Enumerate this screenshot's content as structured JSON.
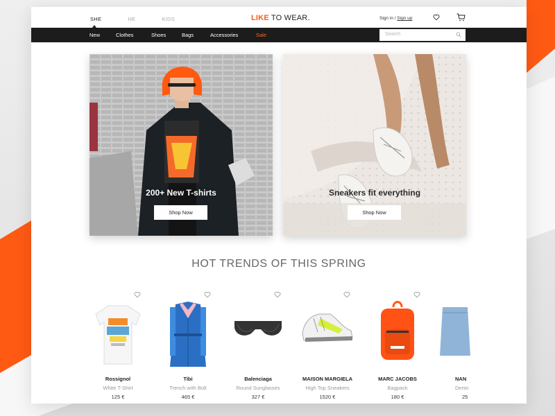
{
  "header": {
    "gender_tabs": [
      {
        "label": "SHE",
        "active": true
      },
      {
        "label": "HE",
        "active": false
      },
      {
        "label": "KIDS",
        "active": false
      }
    ],
    "logo_brand": "LIKE",
    "logo_rest": " TO WEAR.",
    "sign_in": "Sign in",
    "separator": " / ",
    "sign_up": "Sign up"
  },
  "nav": {
    "items": [
      "New",
      "Clothes",
      "Shoes",
      "Bags",
      "Accessories",
      "Sale"
    ],
    "search_placeholder": "Search"
  },
  "banners": [
    {
      "title": "200+ New T-shirts",
      "button": "Shop Now"
    },
    {
      "title": "Sneakers fit everything",
      "button": "Shop Now"
    }
  ],
  "section_title": "HOT TRENDS OF THIS SPRING",
  "products": [
    {
      "brand": "Rossignol",
      "desc": "White T-Shirt",
      "price": "125 €"
    },
    {
      "brand": "Tibi",
      "desc": "Trench with Bolt",
      "price": "465 €"
    },
    {
      "brand": "Balenciaga",
      "desc": "Round Sunglasses",
      "price": "327 €"
    },
    {
      "brand": "MAISON MARGIELA",
      "desc": "High Top Sneakers",
      "price": "1520 €"
    },
    {
      "brand": "MARC JACOBS",
      "desc": "Bagpack",
      "price": "180 €"
    },
    {
      "brand": "NAN",
      "desc": "Denin",
      "price": "25"
    }
  ],
  "colors": {
    "accent": "#ff5a14",
    "nav_bg": "#1c1c1c",
    "sale": "#ff6a1f"
  }
}
